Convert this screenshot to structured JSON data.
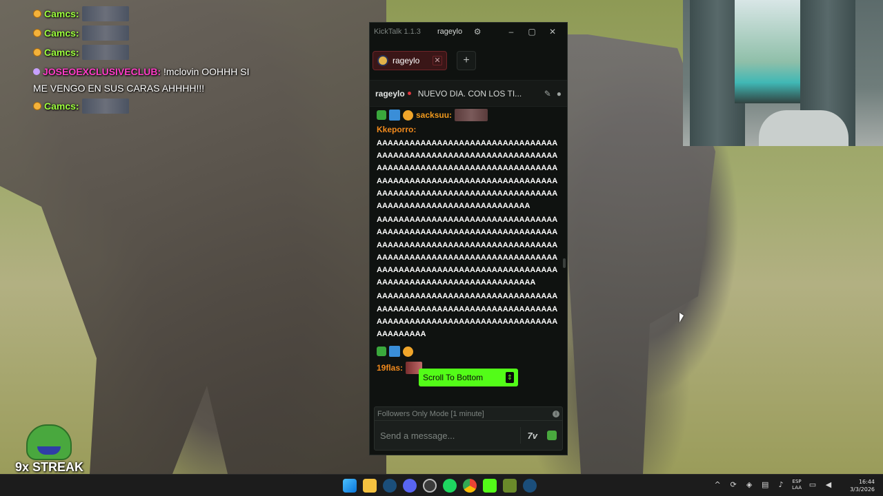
{
  "overlay": {
    "lines": [
      {
        "user": "Camcs:",
        "kind": "emote"
      },
      {
        "user": "Camcs:",
        "kind": "emote"
      },
      {
        "user": "Camcs:",
        "kind": "emote"
      },
      {
        "user": "JOSEOEXCLUSIVECLUB:",
        "message": "!mclovin OOHHH SI ME VENGO EN SUS CARAS AHHHH!!!",
        "kind": "text"
      },
      {
        "user": "Camcs:",
        "kind": "emote"
      }
    ],
    "streak": "9x STREAK"
  },
  "kicktalk": {
    "app_title": "KickTalk 1.1.3",
    "title_user": "rageylo",
    "tab": {
      "label": "rageylo"
    },
    "channel": {
      "name": "rageylo",
      "stream_title": "NUEVO DIA. CON LOS TI..."
    },
    "messages": [
      {
        "user": "sacksuu:"
      },
      {
        "user": "Kkeporro:",
        "text": "AAAAAAAAAAAAAAAAAAAAAAAAAAAAAAAAAAAAAAAAAAAAAAAAAAAAAAAAAAAAAAAAAAAAAAAAAAAAAAAAAAAAAAAAAAAAAAAAAAAAAAAAAAAAAAAAAAAAAAAAAAAAAAAAAAAAAAAAAAAAAAAAAAAAAAAAAAAAAAAAAAAAAAAAAAAAAAAAAAAAAAAAAAAAAAAAA",
        "text2": "AAAAAAAAAAAAAAAAAAAAAAAAAAAAAAAAAAAAAAAAAAAAAAAAAAAAAAAAAAAAAAAAAAAAAAAAAAAAAAAAAAAAAAAAAAAAAAAAAAAAAAAAAAAAAAAAAAAAAAAAAAAAAAAAAAAAAAAAAAAAAAAAAAAAAAAAAAAAAAAAAAAAAAAAAAAAAAAAAAAAAAAAAAAAAAAAAA",
        "text3": "AAAAAAAAAAAAAAAAAAAAAAAAAAAAAAAAAAAAAAAAAAAAAAAAAAAAAAAAAAAAAAAAAAAAAAAAAAAAAAAAAAAAAAAAAAAAAAAAAAAAAAAAAAAA"
      },
      {
        "user": "19flas:"
      }
    ],
    "scroll_to_bottom": "Scroll To Bottom",
    "followers_mode": "Followers Only Mode [1 minute]",
    "input_placeholder": "Send a message...",
    "seventv_label": "7v"
  },
  "taskbar": {
    "lang_top": "ESP",
    "lang_bottom": "LAA",
    "time": "16:44",
    "date": "3/3/2026"
  }
}
